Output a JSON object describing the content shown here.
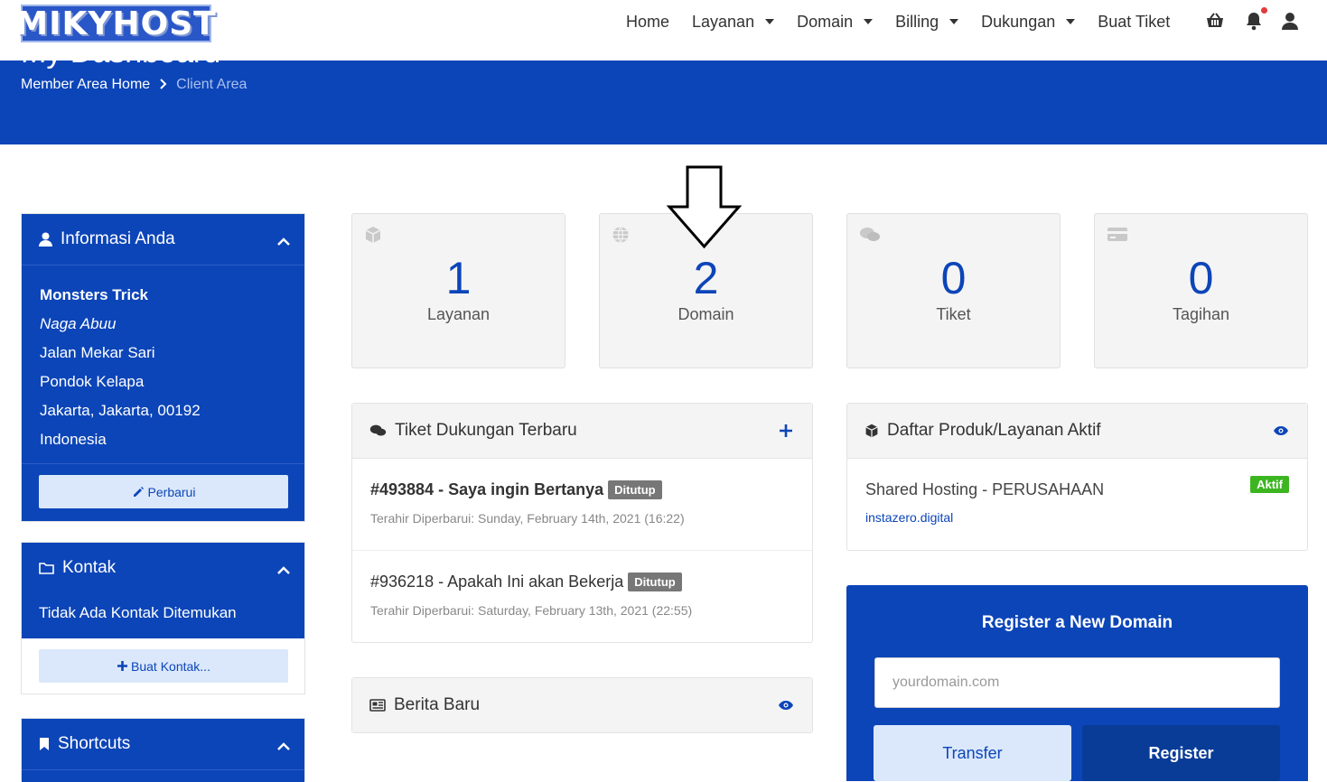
{
  "header": {
    "logo_text": "MIKYHOST",
    "nav": [
      {
        "label": "Home",
        "dropdown": false
      },
      {
        "label": "Layanan",
        "dropdown": true
      },
      {
        "label": "Domain",
        "dropdown": true
      },
      {
        "label": "Billing",
        "dropdown": true
      },
      {
        "label": "Dukungan",
        "dropdown": true
      },
      {
        "label": "Buat Tiket",
        "dropdown": false
      }
    ],
    "icons": [
      "basket-icon",
      "bell-icon",
      "user-icon"
    ]
  },
  "banner": {
    "title": "My Dashboard",
    "breadcrumb": {
      "home": "Member Area Home",
      "current": "Client Area"
    }
  },
  "sidebar": {
    "info": {
      "title": "Informasi Anda",
      "name": "Monsters Trick",
      "company": "Naga Abuu",
      "address1": "Jalan Mekar Sari",
      "address2": "Pondok Kelapa",
      "city_line": "Jakarta, Jakarta, 00192",
      "country": "Indonesia",
      "update_label": "Perbarui"
    },
    "contacts": {
      "title": "Kontak",
      "empty_text": "Tidak Ada Kontak Ditemukan",
      "new_label": "Buat Kontak..."
    },
    "shortcuts": {
      "title": "Shortcuts"
    }
  },
  "stats": [
    {
      "count": "1",
      "label": "Layanan",
      "icon": "cube-icon"
    },
    {
      "count": "2",
      "label": "Domain",
      "icon": "globe-icon"
    },
    {
      "count": "0",
      "label": "Tiket",
      "icon": "comments-icon"
    },
    {
      "count": "0",
      "label": "Tagihan",
      "icon": "credit-card-icon"
    }
  ],
  "tickets": {
    "title": "Tiket Dukungan Terbaru",
    "items": [
      {
        "subject": "#493884 - Saya ingin Bertanya",
        "status": "Ditutup",
        "updated": "Terahir Diperbarui: Sunday, February 14th, 2021 (16:22)",
        "bold": true
      },
      {
        "subject": "#936218 - Apakah Ini akan Bekerja",
        "status": "Ditutup",
        "updated": "Terahir Diperbarui: Saturday, February 13th, 2021 (22:55)",
        "bold": false
      }
    ]
  },
  "products": {
    "title": "Daftar Produk/Layanan Aktif",
    "items": [
      {
        "name": "Shared Hosting - PERUSAHAAN",
        "domain": "instazero.digital",
        "status": "Aktif"
      }
    ]
  },
  "news": {
    "title": "Berita Baru"
  },
  "register": {
    "title": "Register a New Domain",
    "placeholder": "yourdomain.com",
    "transfer_label": "Transfer",
    "register_label": "Register"
  },
  "colors": {
    "primary": "#0c45b8",
    "light_button": "#dbe8fb",
    "dark_button": "#083c97",
    "success": "#3cb521",
    "muted_badge": "#777777"
  }
}
